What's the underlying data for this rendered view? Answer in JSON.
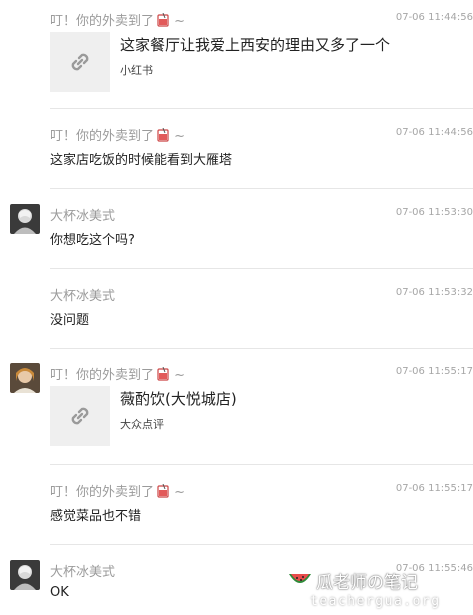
{
  "messages": [
    {
      "sender": "叮！你的外卖到了",
      "suffix": "~",
      "time": "07-06 11:44:56",
      "link": {
        "title": "这家餐厅让我爱上西安的理由又多了一个",
        "source": "小红书"
      }
    },
    {
      "sender": "叮！你的外卖到了",
      "suffix": "~",
      "time": "07-06 11:44:56",
      "text": "这家店吃饭的时候能看到大雁塔"
    },
    {
      "sender": "大杯冰美式",
      "time": "07-06 11:53:30",
      "text": "你想吃这个吗?"
    },
    {
      "sender": "大杯冰美式",
      "time": "07-06 11:53:32",
      "text": "没问题"
    },
    {
      "sender": "叮！你的外卖到了",
      "suffix": "~",
      "time": "07-06 11:55:17",
      "link": {
        "title": "薇酌饮(大悦城店)",
        "source": "大众点评"
      }
    },
    {
      "sender": "叮！你的外卖到了",
      "suffix": "~",
      "time": "07-06 11:55:17",
      "text": "感觉菜品也不错"
    },
    {
      "sender": "大杯冰美式",
      "time": "07-06 11:55:46",
      "text": "OK"
    }
  ],
  "icons": {
    "link": "link-icon",
    "drink": "drink-cup-icon",
    "watermelon": "watermelon-icon"
  },
  "watermark": {
    "title": "瓜老师の笔记",
    "url": "teachergua.org"
  }
}
